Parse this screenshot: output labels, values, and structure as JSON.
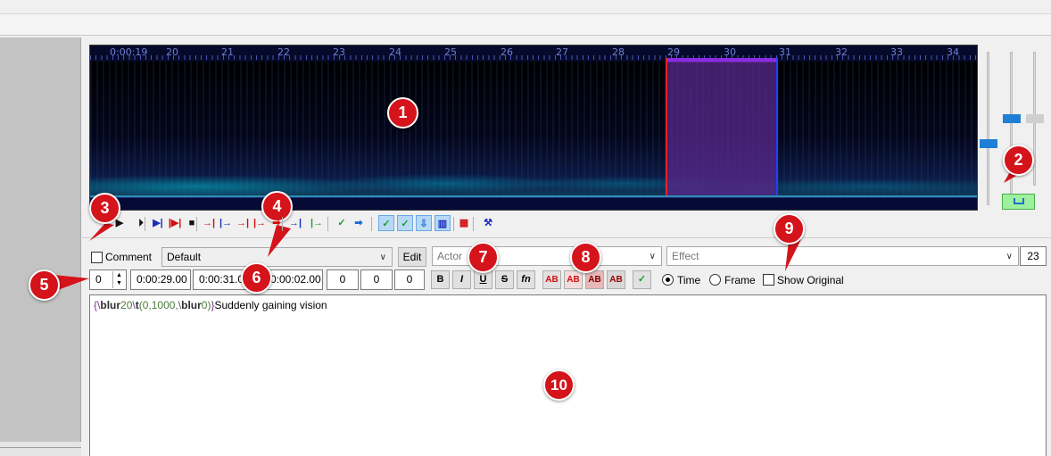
{
  "timeline": {
    "labels": [
      "0:00:19",
      "20",
      "21",
      "22",
      "23",
      "24",
      "25",
      "26",
      "27",
      "28",
      "29",
      "30",
      "31",
      "32",
      "33",
      "34"
    ]
  },
  "toolbar": {
    "buttons": [
      {
        "name": "play-icon",
        "glyph": "▶",
        "cls": ""
      },
      {
        "name": "play-selection-icon",
        "glyph": "⏵",
        "cls": ""
      },
      {
        "name": "play-line-icon",
        "glyph": "▶|",
        "cls": "blue"
      },
      {
        "name": "play-around-icon",
        "glyph": "|▶|",
        "cls": "red"
      },
      {
        "name": "stop-icon",
        "glyph": "■",
        "cls": ""
      },
      {
        "name": "play-before-start-icon",
        "glyph": "→|",
        "cls": "red"
      },
      {
        "name": "play-after-start-icon",
        "glyph": "|→",
        "cls": "blue"
      },
      {
        "name": "play-before-end-icon",
        "glyph": "→|",
        "cls": "red"
      },
      {
        "name": "play-after-end-icon",
        "glyph": "|→",
        "cls": "red"
      },
      {
        "name": "play-end-icon",
        "glyph": "➡",
        "cls": "red"
      },
      {
        "name": "lead-in-icon",
        "glyph": "→|",
        "cls": "blue"
      },
      {
        "name": "lead-out-icon",
        "glyph": "|→",
        "cls": "green"
      },
      {
        "name": "commit-icon",
        "glyph": "✓",
        "cls": "green"
      },
      {
        "name": "next-line-icon",
        "glyph": "➡",
        "cls": "cyan"
      },
      {
        "name": "auto-commit-icon",
        "glyph": "✓",
        "cls": "green on"
      },
      {
        "name": "auto-next-icon",
        "glyph": "✓",
        "cls": "green on"
      },
      {
        "name": "auto-scroll-icon",
        "glyph": "⇩",
        "cls": "cyan on"
      },
      {
        "name": "spectrum-mode-icon",
        "glyph": "▥",
        "cls": "blue on"
      },
      {
        "name": "video-sync-icon",
        "glyph": "▦",
        "cls": "red"
      },
      {
        "name": "karaoke-icon",
        "glyph": "⚒",
        "cls": "blue"
      }
    ]
  },
  "header": {
    "comment_label": "Comment",
    "style_value": "Default",
    "edit_label": "Edit",
    "actor_placeholder": "Actor",
    "effect_placeholder": "Effect",
    "char_count": "23"
  },
  "timing": {
    "layer": "0",
    "start": "0:00:29.00",
    "end": "0:00:31.00",
    "duration": "0:00:02.00",
    "margin_l": "0",
    "margin_r": "0",
    "margin_v": "0"
  },
  "format": {
    "bold": "B",
    "italic": "I",
    "underline": "U",
    "strike": "S",
    "font": "fn",
    "color1": "AB",
    "color2": "AB",
    "color3": "AB",
    "color4": "AB",
    "time_label": "Time",
    "frame_label": "Frame",
    "show_original_label": "Show Original"
  },
  "editor": {
    "brace_open": "{",
    "bs1": "\\",
    "tag1": "blur",
    "num1": "20",
    "bs2": "\\",
    "tag2": "t",
    "args_open": "(0,1000,",
    "bs3": "\\",
    "tag3": "blur",
    "num3": "0",
    "args_close": ")",
    "brace_close": "}",
    "text": "Suddenly gaining vision"
  },
  "markers": [
    "1",
    "2",
    "3",
    "4",
    "5",
    "6",
    "7",
    "8",
    "9",
    "10"
  ],
  "colors": {
    "marker": "#d4131b",
    "selection": "#5a288c",
    "accent": "#1f7fd6"
  }
}
